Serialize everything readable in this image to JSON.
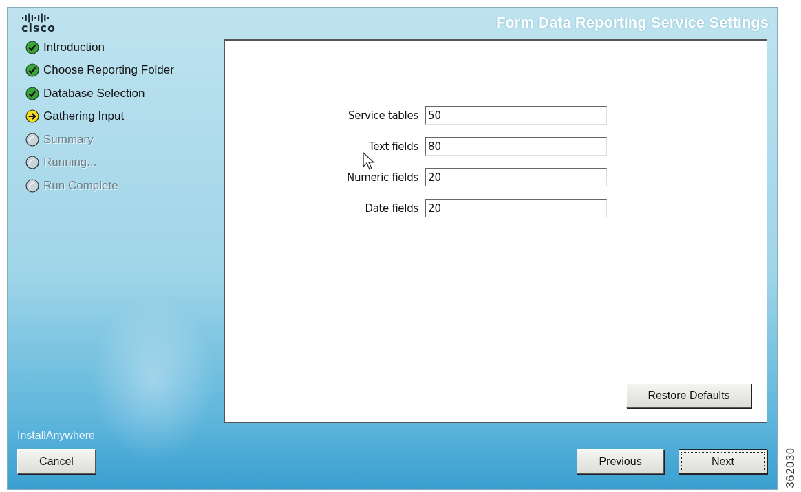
{
  "window": {
    "title": "Form Data Reporting Service Settings"
  },
  "logo": {
    "text": "cisco"
  },
  "steps": [
    {
      "label": "Introduction",
      "kind": "done"
    },
    {
      "label": "Choose Reporting Folder",
      "kind": "done"
    },
    {
      "label": "Database Selection",
      "kind": "done"
    },
    {
      "label": "Gathering Input",
      "kind": "current"
    },
    {
      "label": "Summary",
      "kind": "pending"
    },
    {
      "label": "Running...",
      "kind": "pending"
    },
    {
      "label": "Run Complete",
      "kind": "pending"
    }
  ],
  "fields": [
    {
      "label": "Service tables",
      "value": "50"
    },
    {
      "label": "Text fields",
      "value": "80"
    },
    {
      "label": "Numeric fields",
      "value": "20"
    },
    {
      "label": "Date fields",
      "value": "20"
    }
  ],
  "restore_button": {
    "label": "Restore Defaults",
    "focused": false
  },
  "footer": {
    "brand": "InstallAnywhere"
  },
  "buttons": [
    {
      "label": "Cancel",
      "focused": false
    },
    {
      "label": "Previous",
      "focused": false
    },
    {
      "label": "Next",
      "focused": true
    }
  ],
  "figure_id": "362030"
}
